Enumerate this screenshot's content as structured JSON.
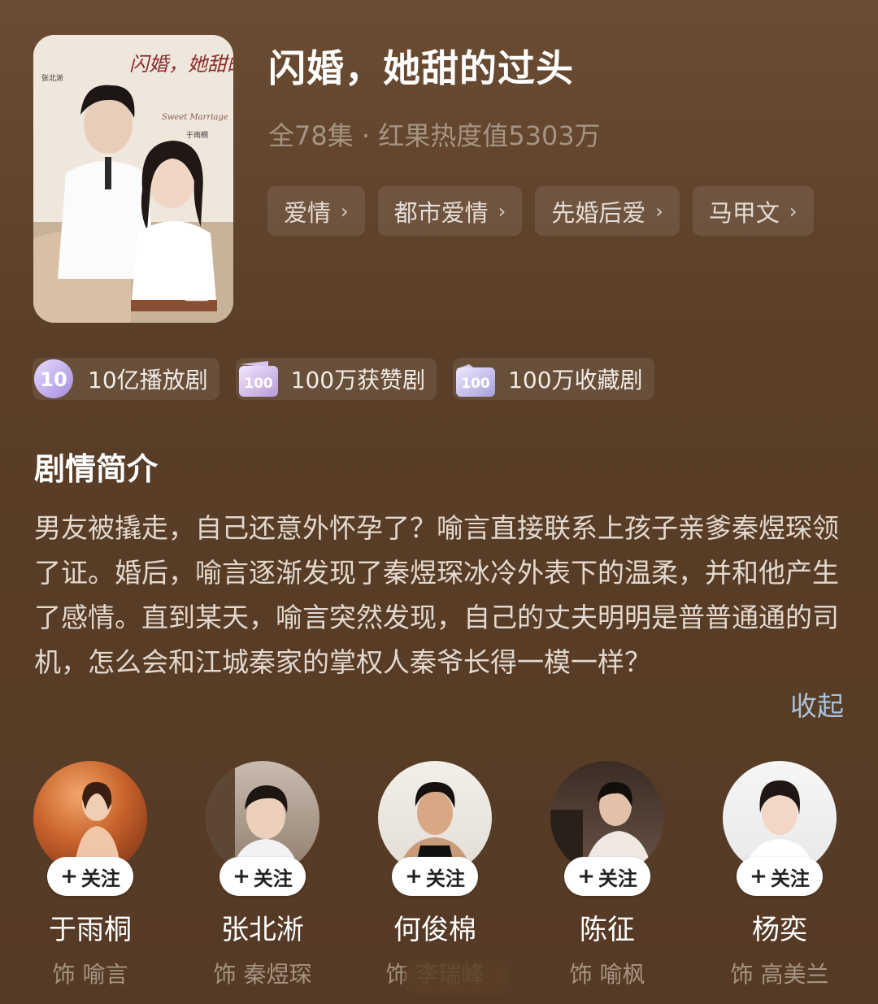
{
  "drama": {
    "title": "闪婚，她甜的过头",
    "meta": "全78集 · 红果热度值5303万",
    "tags": [
      {
        "label": "爱情"
      },
      {
        "label": "都市爱情"
      },
      {
        "label": "先婚后爱"
      },
      {
        "label": "马甲文"
      }
    ],
    "tag_chevron": "›",
    "poster": {
      "title_art": "闪婚，她甜的过头",
      "subtitle_art": "Sweet Marriage",
      "credits_left": "张北淅",
      "credits_right": "于雨桐"
    }
  },
  "badges": [
    {
      "icon": "play-count-icon",
      "label": "10亿播放剧"
    },
    {
      "icon": "likes-icon",
      "label": "100万获赞剧"
    },
    {
      "icon": "favorites-icon",
      "label": "100万收藏剧"
    }
  ],
  "synopsis": {
    "heading": "剧情简介",
    "text": "男友被撬走，自己还意外怀孕了？喻言直接联系上孩子亲爹秦煜琛领了证。婚后，喻言逐渐发现了秦煜琛冰冷外表下的温柔，并和他产生了感情。直到某天，喻言突然发现，自己的丈夫明明是普普通通的司机，怎么会和江城秦家的掌权人秦爷长得一模一样？",
    "collapse_label": "收起"
  },
  "cast": [
    {
      "name": "于雨桐",
      "role": "饰 喻言",
      "follow": "关注"
    },
    {
      "name": "张北淅",
      "role": "饰 秦煜琛",
      "follow": "关注"
    },
    {
      "name": "何俊棉",
      "role": "饰 李瑞峰",
      "follow": "关注"
    },
    {
      "name": "陈征",
      "role": "饰 喻枫",
      "follow": "关注"
    },
    {
      "name": "杨奕",
      "role": "饰 高美兰",
      "follow": "关注"
    }
  ],
  "colors": {
    "background": "#5a3e27",
    "accent_link": "#a9c2da",
    "muted_text": "#a69482"
  }
}
